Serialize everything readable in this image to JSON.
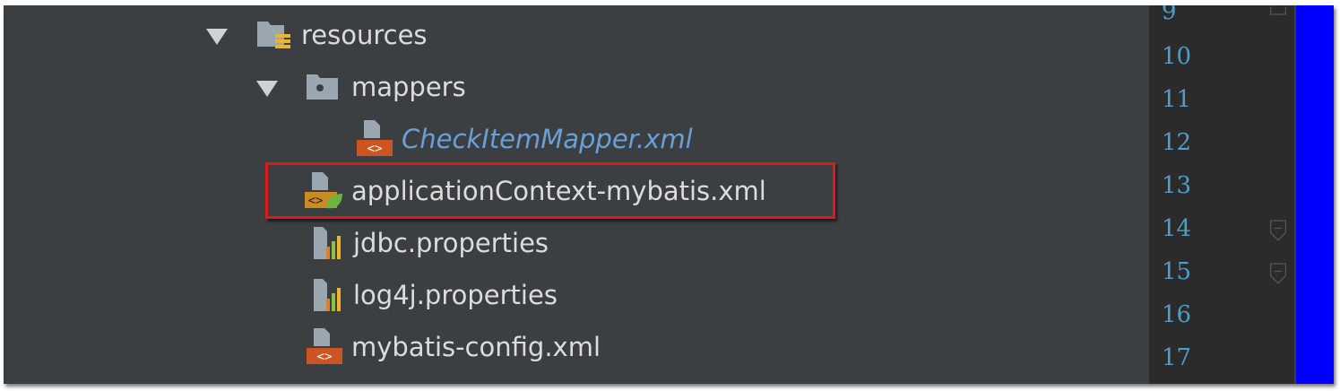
{
  "tree": {
    "items": [
      {
        "label": "resources",
        "icon": "resources-folder-icon",
        "expanded": true
      },
      {
        "label": "mappers",
        "icon": "package-folder-icon",
        "expanded": true
      },
      {
        "label": "CheckItemMapper.xml",
        "icon": "xml-file-icon"
      },
      {
        "label": "applicationContext-mybatis.xml",
        "icon": "spring-xml-file-icon",
        "highlighted": true
      },
      {
        "label": "jdbc.properties",
        "icon": "properties-file-icon"
      },
      {
        "label": "log4j.properties",
        "icon": "properties-file-icon"
      },
      {
        "label": "mybatis-config.xml",
        "icon": "xml-file-icon"
      }
    ]
  },
  "gutter": {
    "line_numbers": [
      "9",
      "10",
      "11",
      "12",
      "13",
      "14",
      "15",
      "16",
      "17"
    ]
  },
  "colors": {
    "panel_bg": "#3c3f41",
    "gutter_bg": "#2b2b2b",
    "line_number": "#4d9ec8",
    "highlight_border": "#e01919",
    "scrollbar": "#0000ff",
    "modified_file": "#6a9fd8"
  }
}
